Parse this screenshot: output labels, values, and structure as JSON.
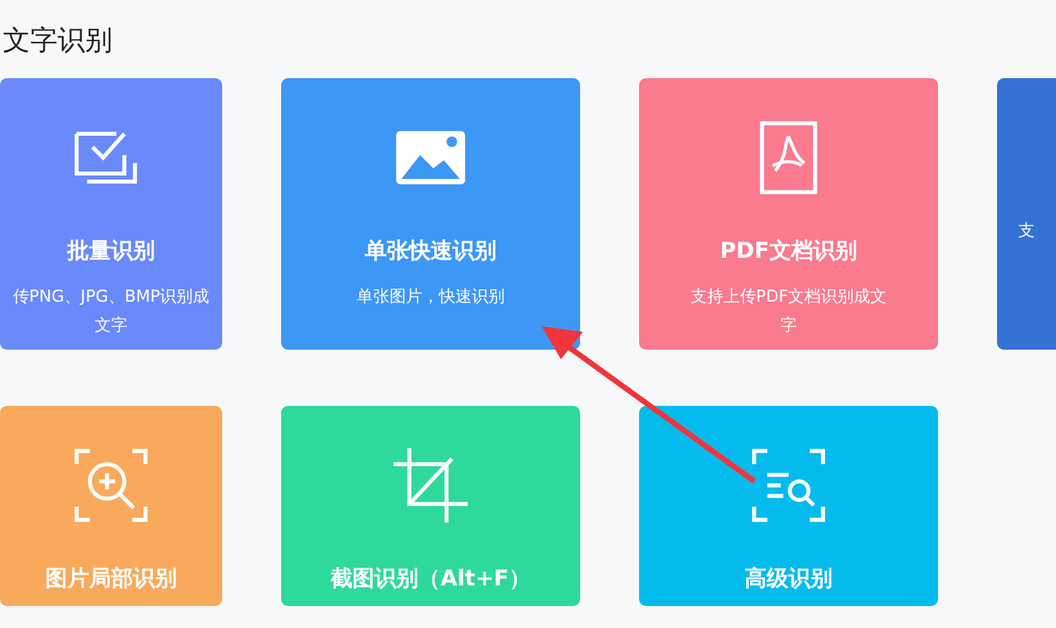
{
  "page_title": "文字识别",
  "cards": [
    {
      "kind": "stack",
      "title": "批量识别",
      "description": "传PNG、JPG、BMP识别成文字",
      "color": "#6a89fb"
    },
    {
      "kind": "image",
      "title": "单张快速识别",
      "description": "单张图片，快速识别",
      "color": "#3d97f5"
    },
    {
      "kind": "pdf",
      "title": "PDF文档识别",
      "description": "支持上传PDF文档识别成文字",
      "color": "#fa7a8e"
    },
    {
      "kind": "none",
      "description": "支",
      "color": "#3572d6"
    },
    {
      "kind": "zoom",
      "title": "图片局部识别",
      "color": "#f8a95c"
    },
    {
      "kind": "crop",
      "title": "截图识别（Alt+F）",
      "color": "#2ed99c"
    },
    {
      "kind": "scan",
      "title": "高级识别",
      "color": "#05bbed"
    }
  ]
}
